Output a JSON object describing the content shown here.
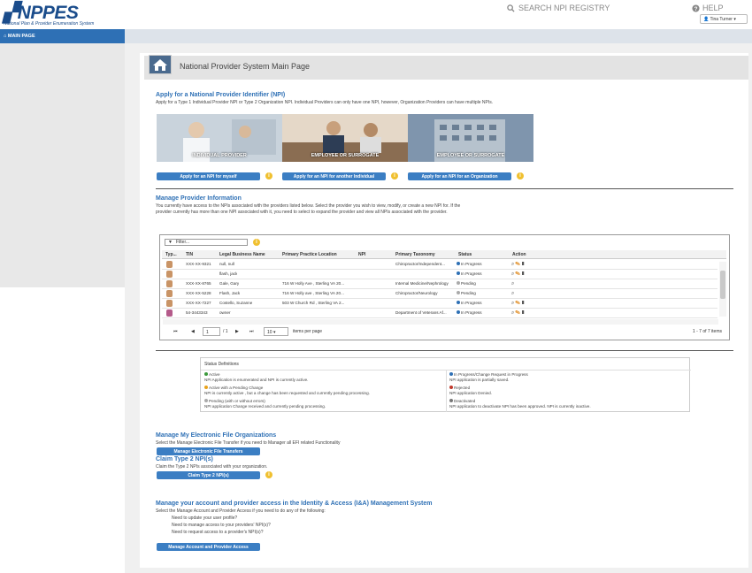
{
  "header": {
    "logo": "NPPES",
    "logo_sub": "National Plan & Provider Enumeration System",
    "search": "SEARCH NPI REGISTRY",
    "help": "HELP",
    "user": "Tina Turner"
  },
  "nav": {
    "main_page": "MAIN PAGE"
  },
  "page": {
    "title": "National Provider System Main Page"
  },
  "apply": {
    "heading": "Apply for a National Provider Identifier (NPI)",
    "desc": "Apply for a Type 1 Individual Provider NPI or Type 2 Organization NPI. Individual Providers can only have one NPI, however, Organization Providers can have multiple NPIs.",
    "photos": [
      {
        "label": "INDIVIDUAL PROVIDER",
        "color": "#a7b5c2"
      },
      {
        "label": "EMPLOYEE OR SURROGATE",
        "color": "#c8a98a"
      },
      {
        "label": "EMPLOYEE OR SURROGATE",
        "color": "#6e84a0"
      }
    ],
    "btn_self": "Apply for an NPI for myself",
    "btn_other": "Apply for an NPI for another Individual",
    "btn_org": "Apply for an NPI for an Organization"
  },
  "manage": {
    "heading": "Manage Provider Information",
    "desc1": "You currently have access to the NPIs associated with the providers listed below. Select the provider you wish to view, modify, or create a new NPI for. If the",
    "desc2": "provider currently has more than one NPI associated with it, you need to select to expand the provider and view all NPIs associated with the provider.",
    "filter": "Filter...",
    "columns": [
      "Typ...",
      "TIN",
      "Legal Business Name",
      "Primary Practice Location",
      "NPI",
      "Primary Taxonomy",
      "Status",
      "Action"
    ],
    "rows": [
      {
        "tin": "XXX-XX-9321",
        "name": "null, null",
        "loc": "",
        "tax": "Chiropractor/Independent...",
        "status": "In Progress"
      },
      {
        "tin": "",
        "name": "flash, jack",
        "loc": "",
        "tax": "",
        "status": "In Progress"
      },
      {
        "tin": "XXX-XX-8765",
        "name": "Gale, Gary",
        "loc": "716 W Holly Ave , Sterling VA 20...",
        "tax": "Internal Medicine/Nephrology",
        "status": "Pending"
      },
      {
        "tin": "XXX-XX-5228",
        "name": "Flash, Jack",
        "loc": "716 W Holly ave , Sterling VA 20...",
        "tax": "Chiropractor/Neurology",
        "status": "Pending"
      },
      {
        "tin": "XXX-XX-7227",
        "name": "Costello, Suzanne",
        "loc": "503 W Church Rd , Sterling VA 2...",
        "tax": "",
        "status": "In Progress"
      },
      {
        "tin": "54-3443343",
        "name": "owner",
        "loc": "",
        "tax": "Department of Veterans Af...",
        "status": "In Progress"
      }
    ],
    "pager": {
      "page": "1",
      "of": "/ 1",
      "per_page": "10",
      "per_label": "items per page",
      "summary": "1 - 7 of 7 items"
    }
  },
  "status_defs": {
    "title": "Status Definitions",
    "items": [
      {
        "name": "Active",
        "desc": "NPI Application is enumerated and NPI is currently active."
      },
      {
        "name": "In Progress/Change Request in Progress",
        "desc": "NPI application is partially saved."
      },
      {
        "name": "Active with a Pending Change",
        "desc": "NPI is currently active , but a change has been requested and currently pending processing."
      },
      {
        "name": "Rejected",
        "desc": "NPI application Denied."
      },
      {
        "name": "Pending   (with or without errors)",
        "desc": "NPI application Change received and currently pending processing."
      },
      {
        "name": "Deactivated",
        "desc": "NPI application to deactivate NPI has been approved. NPI is currently inactive."
      }
    ]
  },
  "efi": {
    "heading": "Manage My Electronic File Organizations",
    "desc": "Select the Manage Electronic File Transfer if you need to Manager all EFI related Functionality",
    "btn": "Manage Electronic File Transfers"
  },
  "claim": {
    "heading": "Claim Type 2 NPI(s)",
    "desc": "Claim the Type 2 NPIs associated with your organization.",
    "btn": "Claim Type 2 NPI(s)"
  },
  "ia": {
    "heading": "Manage your account and provider access in the Identity & Access (I&A) Management System",
    "desc": "Select the Manage Account and Provider Access if you need to do any of the following:",
    "l1": "Need to update your user profile?",
    "l2": "Need to manage access to your providers' NPI(s)?",
    "l3": "Need to request access to a provider's NPI(s)?",
    "btn": "Manage Account and Provider Access"
  }
}
